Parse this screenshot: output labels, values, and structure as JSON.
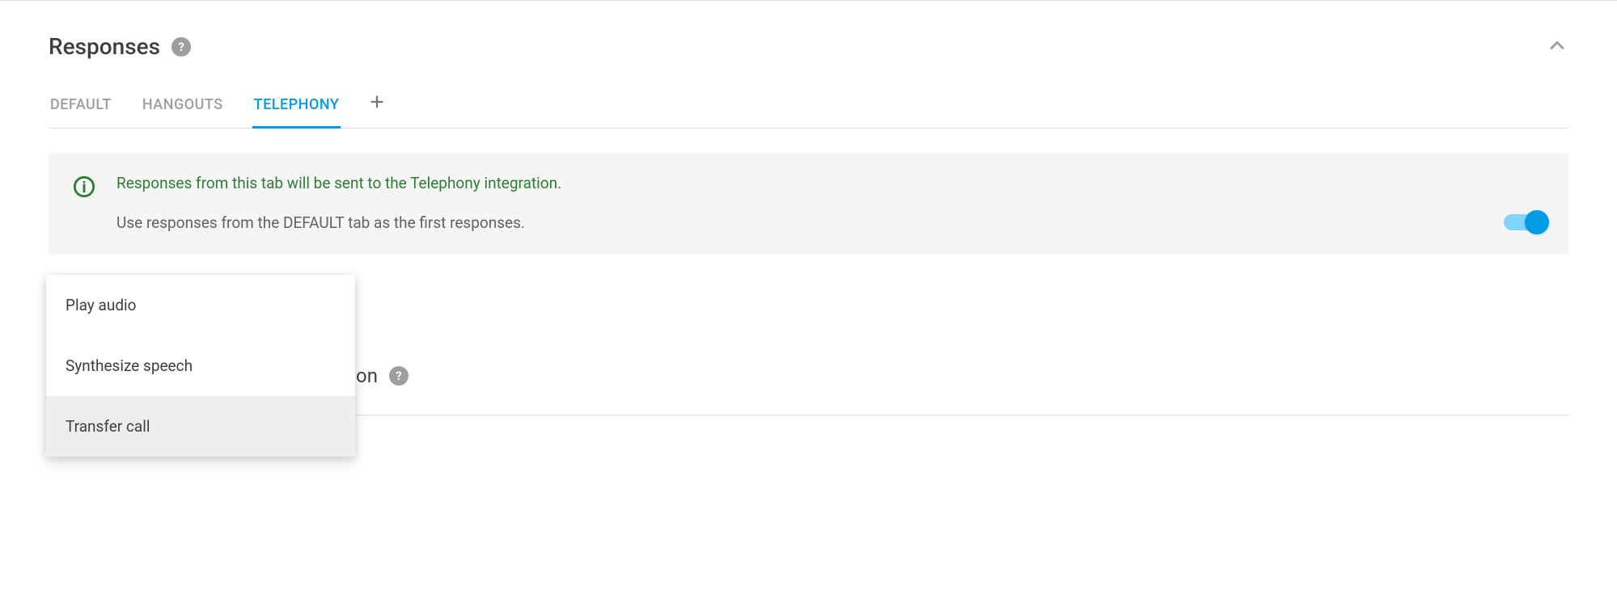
{
  "section": {
    "title": "Responses"
  },
  "tabs": {
    "items": [
      {
        "label": "DEFAULT",
        "active": false
      },
      {
        "label": "HANGOUTS",
        "active": false
      },
      {
        "label": "TELEPHONY",
        "active": true
      }
    ]
  },
  "banner": {
    "line1": "Responses from this tab will be sent to the Telephony integration.",
    "line2": "Use responses from the DEFAULT tab as the first responses.",
    "toggle_on": true
  },
  "dropdown": {
    "items": [
      {
        "label": "Play audio",
        "hovered": false
      },
      {
        "label": "Synthesize speech",
        "hovered": false
      },
      {
        "label": "Transfer call",
        "hovered": true
      }
    ]
  },
  "obscured": {
    "partial_text": "on"
  }
}
